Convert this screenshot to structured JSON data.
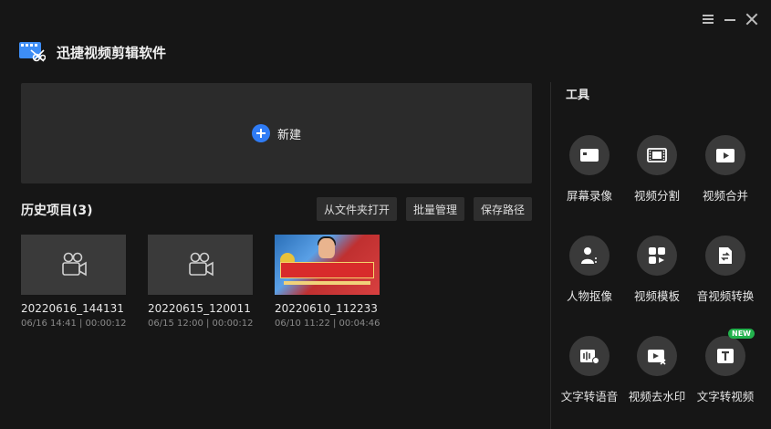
{
  "app": {
    "title": "迅捷视频剪辑软件"
  },
  "window": {
    "menu_icon": "menu-icon",
    "minimize_icon": "minimize-icon",
    "close_icon": "close-icon"
  },
  "new_project": {
    "label": "新建",
    "icon": "plus-icon",
    "accent": "#2f7cf6"
  },
  "history": {
    "title": "历史项目(3)",
    "actions": [
      {
        "label": "从文件夹打开"
      },
      {
        "label": "批量管理"
      },
      {
        "label": "保存路径"
      }
    ],
    "projects": [
      {
        "name": "20220616_144131",
        "meta": "06/16 14:41 | 00:00:12",
        "thumb": "camera-icon"
      },
      {
        "name": "20220615_120011",
        "meta": "06/15 12:00 | 00:00:12",
        "thumb": "camera-icon"
      },
      {
        "name": "20220610_112233",
        "meta": "06/10 11:22 | 00:04:46",
        "thumb": "photo"
      }
    ]
  },
  "tools": {
    "title": "工具",
    "items": [
      {
        "label": "屏幕录像",
        "icon": "screen-record-icon"
      },
      {
        "label": "视频分割",
        "icon": "video-split-icon"
      },
      {
        "label": "视频合并",
        "icon": "video-merge-icon"
      },
      {
        "label": "人物抠像",
        "icon": "person-cutout-icon"
      },
      {
        "label": "视频模板",
        "icon": "video-template-icon"
      },
      {
        "label": "音视频转换",
        "icon": "av-convert-icon"
      },
      {
        "label": "文字转语音",
        "icon": "text-to-speech-icon"
      },
      {
        "label": "视频去水印",
        "icon": "watermark-remove-icon"
      },
      {
        "label": "文字转视频",
        "icon": "text-to-video-icon",
        "badge": "NEW"
      }
    ]
  },
  "colors": {
    "background": "#161616",
    "panel": "#2b2b2b",
    "badge": "#22b14c"
  }
}
